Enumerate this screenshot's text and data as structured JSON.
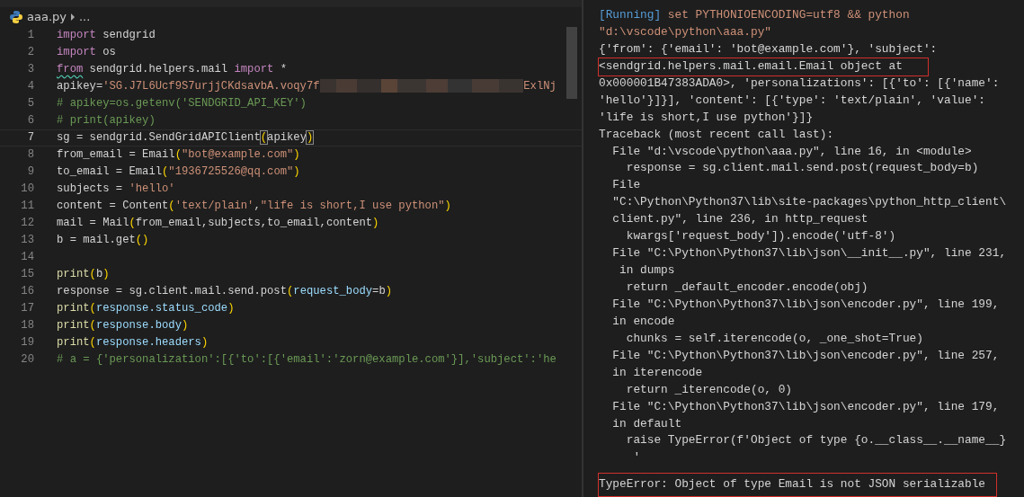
{
  "breadcrumb": {
    "file": "aaa.py",
    "more": "..."
  },
  "code_lines": [
    {
      "n": "1",
      "current": false,
      "tokens": [
        {
          "kind": "kw",
          "t": "import"
        },
        {
          "kind": "id",
          "t": " sendgrid"
        }
      ]
    },
    {
      "n": "2",
      "current": false,
      "tokens": [
        {
          "kind": "kw",
          "t": "import"
        },
        {
          "kind": "id",
          "t": " os"
        }
      ]
    },
    {
      "n": "3",
      "current": false,
      "tokens": [
        {
          "kind": "kw",
          "t": "from",
          "warn": true
        },
        {
          "kind": "id",
          "t": " sendgrid.helpers.mail "
        },
        {
          "kind": "kw",
          "t": "import"
        },
        {
          "kind": "id",
          "t": " *"
        }
      ]
    },
    {
      "n": "4",
      "current": false,
      "tokens": [
        {
          "kind": "id",
          "t": "apikey="
        },
        {
          "kind": "str",
          "t": "'SG.J7L6Ucf9S7urjjCKdsavbA.voqy7f"
        },
        {
          "kind": "redacted"
        },
        {
          "kind": "str",
          "t": "ExlNj"
        }
      ]
    },
    {
      "n": "5",
      "current": false,
      "tokens": [
        {
          "kind": "cmt",
          "t": "# apikey=os.getenv('SENDGRID_API_KEY')"
        }
      ]
    },
    {
      "n": "6",
      "current": false,
      "tokens": [
        {
          "kind": "cmt",
          "t": "# print(apikey)"
        }
      ]
    },
    {
      "n": "7",
      "current": true,
      "tokens": [
        {
          "kind": "id",
          "t": "sg = sendgrid.SendGridAPIClient"
        },
        {
          "kind": "br",
          "t": "(",
          "matched": true
        },
        {
          "kind": "id",
          "t": "apikey"
        },
        {
          "kind": "br",
          "t": ")",
          "matched": true
        }
      ]
    },
    {
      "n": "8",
      "current": false,
      "tokens": [
        {
          "kind": "id",
          "t": "from_email = Email"
        },
        {
          "kind": "br",
          "t": "("
        },
        {
          "kind": "str",
          "t": "\"bot@example.com\""
        },
        {
          "kind": "br",
          "t": ")"
        }
      ]
    },
    {
      "n": "9",
      "current": false,
      "tokens": [
        {
          "kind": "id",
          "t": "to_email = Email"
        },
        {
          "kind": "br",
          "t": "("
        },
        {
          "kind": "str",
          "t": "\"1936725526@qq.com\""
        },
        {
          "kind": "br",
          "t": ")"
        }
      ]
    },
    {
      "n": "10",
      "current": false,
      "tokens": [
        {
          "kind": "id",
          "t": "subjects = "
        },
        {
          "kind": "str",
          "t": "'hello'"
        }
      ]
    },
    {
      "n": "11",
      "current": false,
      "tokens": [
        {
          "kind": "id",
          "t": "content = Content"
        },
        {
          "kind": "br",
          "t": "("
        },
        {
          "kind": "str",
          "t": "'text/plain'"
        },
        {
          "kind": "id",
          "t": ","
        },
        {
          "kind": "str",
          "t": "\"life is short,I use python\""
        },
        {
          "kind": "br",
          "t": ")"
        }
      ]
    },
    {
      "n": "12",
      "current": false,
      "tokens": [
        {
          "kind": "id",
          "t": "mail = Mail"
        },
        {
          "kind": "br",
          "t": "("
        },
        {
          "kind": "id",
          "t": "from_email,subjects,to_email,content"
        },
        {
          "kind": "br",
          "t": ")"
        }
      ]
    },
    {
      "n": "13",
      "current": false,
      "tokens": [
        {
          "kind": "id",
          "t": "b = mail.get"
        },
        {
          "kind": "br",
          "t": "()"
        }
      ]
    },
    {
      "n": "14",
      "current": false
    },
    {
      "n": "15",
      "current": false,
      "tokens": [
        {
          "kind": "fn",
          "t": "print"
        },
        {
          "kind": "br",
          "t": "("
        },
        {
          "kind": "id",
          "t": "b"
        },
        {
          "kind": "br",
          "t": ")"
        }
      ]
    },
    {
      "n": "16",
      "current": false,
      "tokens": [
        {
          "kind": "id",
          "t": "response = sg.client.mail.send.post"
        },
        {
          "kind": "br",
          "t": "("
        },
        {
          "kind": "var",
          "t": "request_body"
        },
        {
          "kind": "id",
          "t": "=b"
        },
        {
          "kind": "br",
          "t": ")"
        }
      ]
    },
    {
      "n": "17",
      "current": false,
      "tokens": [
        {
          "kind": "fn",
          "t": "print"
        },
        {
          "kind": "br",
          "t": "("
        },
        {
          "kind": "var",
          "t": "response.status_code"
        },
        {
          "kind": "br",
          "t": ")"
        }
      ]
    },
    {
      "n": "18",
      "current": false,
      "tokens": [
        {
          "kind": "fn",
          "t": "print"
        },
        {
          "kind": "br",
          "t": "("
        },
        {
          "kind": "var",
          "t": "response.body"
        },
        {
          "kind": "br",
          "t": ")"
        }
      ]
    },
    {
      "n": "19",
      "current": false,
      "tokens": [
        {
          "kind": "fn",
          "t": "print"
        },
        {
          "kind": "br",
          "t": "("
        },
        {
          "kind": "var",
          "t": "response.headers"
        },
        {
          "kind": "br",
          "t": ")"
        }
      ]
    },
    {
      "n": "20",
      "current": false,
      "tokens": [
        {
          "kind": "cmt",
          "t": "# a = {'personalization':[{'to':[{'email':'zorn@example.com'}],'subject':'he"
        }
      ]
    }
  ],
  "output_lines": [
    {
      "boxed": false,
      "parts": [
        {
          "kind": "info",
          "t": "[Running]"
        },
        {
          "kind": "cmd",
          "t": " set PYTHONIOENCODING=utf8 && python"
        }
      ]
    },
    {
      "boxed": false,
      "parts": [
        {
          "kind": "cmd",
          "t": "\"d:\\vscode\\python\\aaa.py\""
        }
      ]
    },
    {
      "boxed": false,
      "parts": [
        {
          "kind": "out",
          "t": "{'from': {'email': 'bot@example.com'}, 'subject':"
        }
      ]
    },
    {
      "boxed": true,
      "parts": [
        {
          "kind": "out",
          "t": "<sendgrid.helpers.mail.email.Email object at"
        }
      ]
    },
    {
      "boxed": false,
      "parts": [
        {
          "kind": "out",
          "t": "0x000001B47383ADA0>, 'personalizations': [{'to': [{'name':"
        }
      ]
    },
    {
      "boxed": false,
      "parts": [
        {
          "kind": "out",
          "t": "'hello'}]}], 'content': [{'type': 'text/plain', 'value':"
        }
      ]
    },
    {
      "boxed": false,
      "parts": [
        {
          "kind": "out",
          "t": "'life is short,I use python'}]}"
        }
      ]
    },
    {
      "boxed": false,
      "parts": [
        {
          "kind": "out",
          "t": "Traceback (most recent call last):"
        }
      ]
    },
    {
      "boxed": false,
      "parts": [
        {
          "kind": "out",
          "t": "  File \"d:\\vscode\\python\\aaa.py\", line 16, in <module>"
        }
      ]
    },
    {
      "boxed": false,
      "parts": [
        {
          "kind": "out",
          "t": "    response = sg.client.mail.send.post(request_body=b)"
        }
      ]
    },
    {
      "boxed": false,
      "parts": [
        {
          "kind": "out",
          "t": "  File"
        }
      ]
    },
    {
      "boxed": false,
      "parts": [
        {
          "kind": "out",
          "t": "  \"C:\\Python\\Python37\\lib\\site-packages\\python_http_client\\"
        }
      ]
    },
    {
      "boxed": false,
      "parts": [
        {
          "kind": "out",
          "t": "  client.py\", line 236, in http_request"
        }
      ]
    },
    {
      "boxed": false,
      "parts": [
        {
          "kind": "out",
          "t": "    kwargs['request_body']).encode('utf-8')"
        }
      ]
    },
    {
      "boxed": false,
      "parts": [
        {
          "kind": "out",
          "t": "  File \"C:\\Python\\Python37\\lib\\json\\__init__.py\", line 231,"
        }
      ]
    },
    {
      "boxed": false,
      "parts": [
        {
          "kind": "out",
          "t": "   in dumps"
        }
      ]
    },
    {
      "boxed": false,
      "parts": [
        {
          "kind": "out",
          "t": "    return _default_encoder.encode(obj)"
        }
      ]
    },
    {
      "boxed": false,
      "parts": [
        {
          "kind": "out",
          "t": "  File \"C:\\Python\\Python37\\lib\\json\\encoder.py\", line 199,"
        }
      ]
    },
    {
      "boxed": false,
      "parts": [
        {
          "kind": "out",
          "t": "  in encode"
        }
      ]
    },
    {
      "boxed": false,
      "parts": [
        {
          "kind": "out",
          "t": "    chunks = self.iterencode(o, _one_shot=True)"
        }
      ]
    },
    {
      "boxed": false,
      "parts": [
        {
          "kind": "out",
          "t": "  File \"C:\\Python\\Python37\\lib\\json\\encoder.py\", line 257,"
        }
      ]
    },
    {
      "boxed": false,
      "parts": [
        {
          "kind": "out",
          "t": "  in iterencode"
        }
      ]
    },
    {
      "boxed": false,
      "parts": [
        {
          "kind": "out",
          "t": "    return _iterencode(o, 0)"
        }
      ]
    },
    {
      "boxed": false,
      "parts": [
        {
          "kind": "out",
          "t": "  File \"C:\\Python\\Python37\\lib\\json\\encoder.py\", line 179,"
        }
      ]
    },
    {
      "boxed": false,
      "parts": [
        {
          "kind": "out",
          "t": "  in default"
        }
      ]
    },
    {
      "boxed": false,
      "parts": [
        {
          "kind": "out",
          "t": "    raise TypeError(f'Object of type {o.__class__.__name__}"
        }
      ]
    },
    {
      "boxed": false,
      "parts": [
        {
          "kind": "out",
          "t": "     '"
        }
      ]
    },
    {
      "boxed": true,
      "parts": [
        {
          "kind": "out",
          "t": "TypeError: Object of type Email is not JSON serializable"
        }
      ]
    }
  ]
}
